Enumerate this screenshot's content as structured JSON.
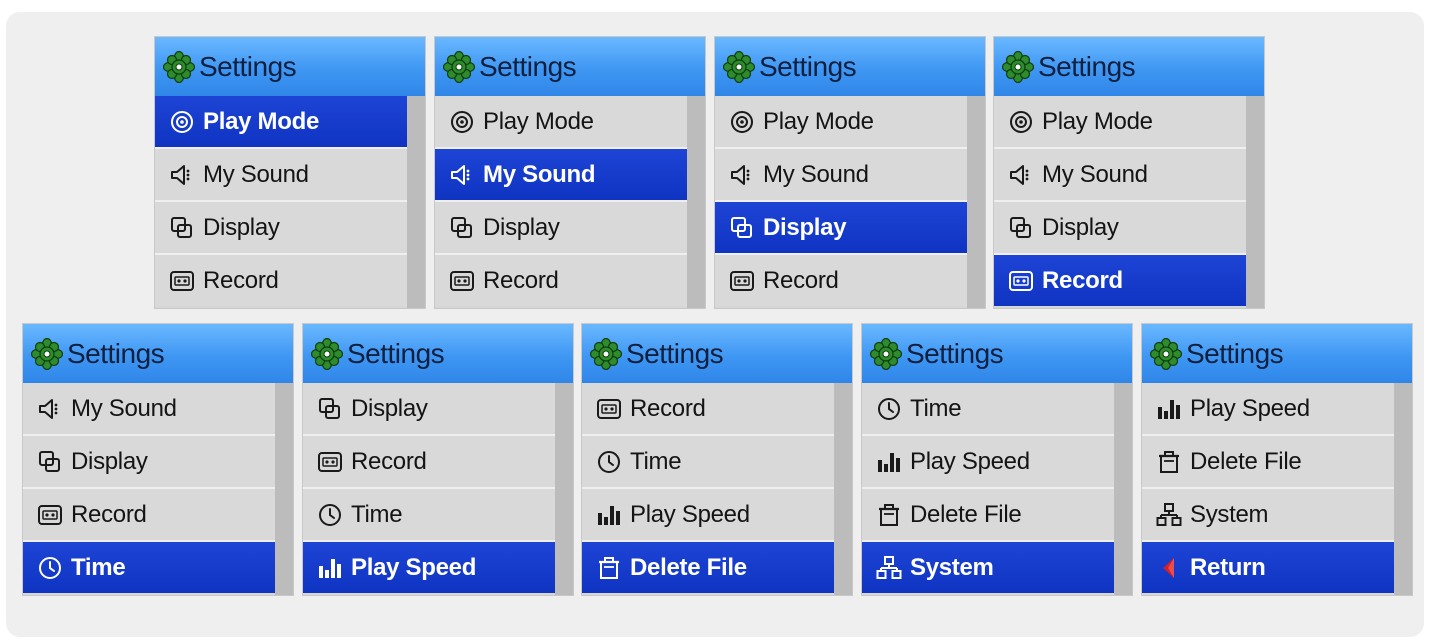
{
  "panels": [
    {
      "title": "Settings",
      "items": [
        {
          "label": "Play Mode",
          "icon": "play-mode-icon",
          "selected": true
        },
        {
          "label": "My Sound",
          "icon": "sound-icon",
          "selected": false
        },
        {
          "label": "Display",
          "icon": "display-icon",
          "selected": false
        },
        {
          "label": "Record",
          "icon": "record-icon",
          "selected": false
        }
      ]
    },
    {
      "title": "Settings",
      "items": [
        {
          "label": "Play Mode",
          "icon": "play-mode-icon",
          "selected": false
        },
        {
          "label": "My Sound",
          "icon": "sound-icon",
          "selected": true
        },
        {
          "label": "Display",
          "icon": "display-icon",
          "selected": false
        },
        {
          "label": "Record",
          "icon": "record-icon",
          "selected": false
        }
      ]
    },
    {
      "title": "Settings",
      "items": [
        {
          "label": "Play Mode",
          "icon": "play-mode-icon",
          "selected": false
        },
        {
          "label": "My Sound",
          "icon": "sound-icon",
          "selected": false
        },
        {
          "label": "Display",
          "icon": "display-icon",
          "selected": true
        },
        {
          "label": "Record",
          "icon": "record-icon",
          "selected": false
        }
      ]
    },
    {
      "title": "Settings",
      "items": [
        {
          "label": "Play Mode",
          "icon": "play-mode-icon",
          "selected": false
        },
        {
          "label": "My Sound",
          "icon": "sound-icon",
          "selected": false
        },
        {
          "label": "Display",
          "icon": "display-icon",
          "selected": false
        },
        {
          "label": "Record",
          "icon": "record-icon",
          "selected": true
        }
      ]
    },
    {
      "title": "Settings",
      "items": [
        {
          "label": "My Sound",
          "icon": "sound-icon",
          "selected": false
        },
        {
          "label": "Display",
          "icon": "display-icon",
          "selected": false
        },
        {
          "label": "Record",
          "icon": "record-icon",
          "selected": false
        },
        {
          "label": "Time",
          "icon": "clock-icon",
          "selected": true
        }
      ]
    },
    {
      "title": "Settings",
      "items": [
        {
          "label": "Display",
          "icon": "display-icon",
          "selected": false
        },
        {
          "label": "Record",
          "icon": "record-icon",
          "selected": false
        },
        {
          "label": "Time",
          "icon": "clock-icon",
          "selected": false
        },
        {
          "label": "Play Speed",
          "icon": "play-speed-icon",
          "selected": true
        }
      ]
    },
    {
      "title": "Settings",
      "items": [
        {
          "label": "Record",
          "icon": "record-icon",
          "selected": false
        },
        {
          "label": "Time",
          "icon": "clock-icon",
          "selected": false
        },
        {
          "label": "Play Speed",
          "icon": "play-speed-icon",
          "selected": false
        },
        {
          "label": "Delete File",
          "icon": "trash-icon",
          "selected": true
        }
      ]
    },
    {
      "title": "Settings",
      "items": [
        {
          "label": "Time",
          "icon": "clock-icon",
          "selected": false
        },
        {
          "label": "Play Speed",
          "icon": "play-speed-icon",
          "selected": false
        },
        {
          "label": "Delete File",
          "icon": "trash-icon",
          "selected": false
        },
        {
          "label": "System",
          "icon": "system-icon",
          "selected": true
        }
      ]
    },
    {
      "title": "Settings",
      "items": [
        {
          "label": "Play Speed",
          "icon": "play-speed-icon",
          "selected": false
        },
        {
          "label": "Delete File",
          "icon": "trash-icon",
          "selected": false
        },
        {
          "label": "System",
          "icon": "system-icon",
          "selected": false
        },
        {
          "label": "Return",
          "icon": "return-icon",
          "selected": true
        }
      ]
    }
  ],
  "colors": {
    "header_top": "#6ab8ff",
    "header_bottom": "#2f86e8",
    "selected_row": "#1e44d6",
    "row_bg": "#d9d9d9",
    "scrollbar": "#bcbcbc",
    "gear": "#2e8b2e",
    "return_arrow": "#d0202a"
  }
}
